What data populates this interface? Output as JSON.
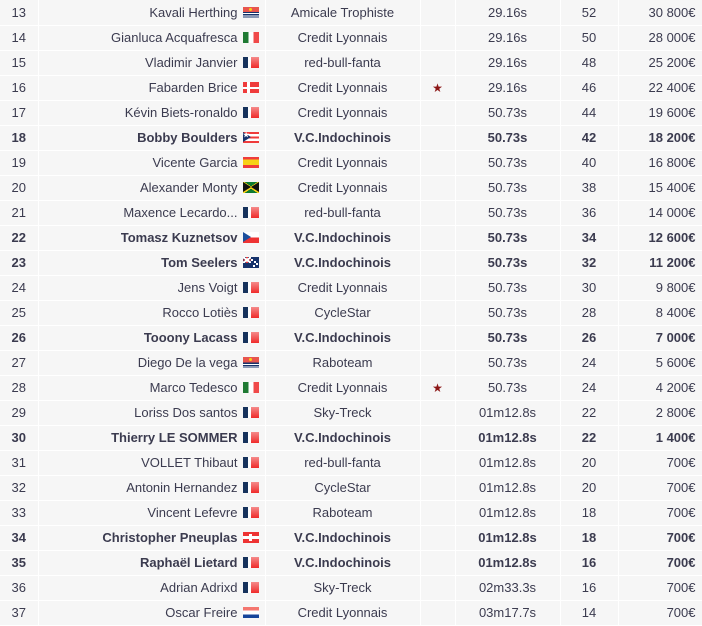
{
  "colors": {
    "row_background": "#f6f6f6",
    "page_background": "#ffffff",
    "default_text": "#3b3b4f",
    "name_text": "#a9cd5e",
    "highlight_text": "#00b400",
    "star_marker": "#8c1616"
  },
  "table": {
    "name": "race-ranking-table",
    "star_symbol": "★",
    "rows": [
      {
        "rank": "13",
        "name": "Kavali Herthing",
        "flag": "ki",
        "flag_name": "flag-kiribati",
        "team": "Amicale Trophiste",
        "star": "",
        "time": "29.16s",
        "points": "52",
        "cash": "30 800€",
        "highlight": false
      },
      {
        "rank": "14",
        "name": "Gianluca Acquafresca",
        "flag": "it",
        "flag_name": "flag-italy",
        "team": "Credit Lyonnais",
        "star": "",
        "time": "29.16s",
        "points": "50",
        "cash": "28 000€",
        "highlight": false
      },
      {
        "rank": "15",
        "name": "Vladimir Janvier",
        "flag": "fr",
        "flag_name": "flag-france",
        "team": "red-bull-fanta",
        "star": "",
        "time": "29.16s",
        "points": "48",
        "cash": "25 200€",
        "highlight": false
      },
      {
        "rank": "16",
        "name": "Fabarden Brice",
        "flag": "dk",
        "flag_name": "flag-denmark",
        "team": "Credit Lyonnais",
        "star": "★",
        "time": "29.16s",
        "points": "46",
        "cash": "22 400€",
        "highlight": false
      },
      {
        "rank": "17",
        "name": "Kévin Biets-ronaldo",
        "flag": "fr",
        "flag_name": "flag-france",
        "team": "Credit Lyonnais",
        "star": "",
        "time": "50.73s",
        "points": "44",
        "cash": "19 600€",
        "highlight": false
      },
      {
        "rank": "18",
        "name": "Bobby Boulders",
        "flag": "pr",
        "flag_name": "flag-puerto-rico",
        "team": "V.C.Indochinois",
        "star": "",
        "time": "50.73s",
        "points": "42",
        "cash": "18 200€",
        "highlight": true
      },
      {
        "rank": "19",
        "name": "Vicente Garcia",
        "flag": "es",
        "flag_name": "flag-spain",
        "team": "Credit Lyonnais",
        "star": "",
        "time": "50.73s",
        "points": "40",
        "cash": "16 800€",
        "highlight": false
      },
      {
        "rank": "20",
        "name": "Alexander Monty",
        "flag": "jm",
        "flag_name": "flag-jamaica",
        "team": "Credit Lyonnais",
        "star": "",
        "time": "50.73s",
        "points": "38",
        "cash": "15 400€",
        "highlight": false
      },
      {
        "rank": "21",
        "name": "Maxence Lecardo...",
        "flag": "fr",
        "flag_name": "flag-france",
        "team": "red-bull-fanta",
        "star": "",
        "time": "50.73s",
        "points": "36",
        "cash": "14 000€",
        "highlight": false
      },
      {
        "rank": "22",
        "name": "Tomasz Kuznetsov",
        "flag": "cz",
        "flag_name": "flag-czech-republic",
        "team": "V.C.Indochinois",
        "star": "",
        "time": "50.73s",
        "points": "34",
        "cash": "12 600€",
        "highlight": true
      },
      {
        "rank": "23",
        "name": "Tom Seelers",
        "flag": "nz",
        "flag_name": "flag-new-zealand",
        "team": "V.C.Indochinois",
        "star": "",
        "time": "50.73s",
        "points": "32",
        "cash": "11 200€",
        "highlight": true
      },
      {
        "rank": "24",
        "name": "Jens Voigt",
        "flag": "fr",
        "flag_name": "flag-france",
        "team": "Credit Lyonnais",
        "star": "",
        "time": "50.73s",
        "points": "30",
        "cash": "9 800€",
        "highlight": false
      },
      {
        "rank": "25",
        "name": "Rocco Lotiès",
        "flag": "fr",
        "flag_name": "flag-france",
        "team": "CycleStar",
        "star": "",
        "time": "50.73s",
        "points": "28",
        "cash": "8 400€",
        "highlight": false
      },
      {
        "rank": "26",
        "name": "Tooony Lacass",
        "flag": "fr",
        "flag_name": "flag-france",
        "team": "V.C.Indochinois",
        "star": "",
        "time": "50.73s",
        "points": "26",
        "cash": "7 000€",
        "highlight": true
      },
      {
        "rank": "27",
        "name": "Diego De la vega",
        "flag": "ki",
        "flag_name": "flag-kiribati",
        "team": "Raboteam",
        "star": "",
        "time": "50.73s",
        "points": "24",
        "cash": "5 600€",
        "highlight": false
      },
      {
        "rank": "28",
        "name": "Marco Tedesco",
        "flag": "it",
        "flag_name": "flag-italy",
        "team": "Credit Lyonnais",
        "star": "★",
        "time": "50.73s",
        "points": "24",
        "cash": "4 200€",
        "highlight": false
      },
      {
        "rank": "29",
        "name": "Loriss Dos santos",
        "flag": "fr",
        "flag_name": "flag-france",
        "team": "Sky-Treck",
        "star": "",
        "time": "01m12.8s",
        "points": "22",
        "cash": "2 800€",
        "highlight": false
      },
      {
        "rank": "30",
        "name": "Thierry LE SOMMER",
        "flag": "fr",
        "flag_name": "flag-france",
        "team": "V.C.Indochinois",
        "star": "",
        "time": "01m12.8s",
        "points": "22",
        "cash": "1 400€",
        "highlight": true
      },
      {
        "rank": "31",
        "name": "VOLLET Thibaut",
        "flag": "fr",
        "flag_name": "flag-france",
        "team": "red-bull-fanta",
        "star": "",
        "time": "01m12.8s",
        "points": "20",
        "cash": "700€",
        "highlight": false
      },
      {
        "rank": "32",
        "name": "Antonin Hernandez",
        "flag": "fr",
        "flag_name": "flag-france",
        "team": "CycleStar",
        "star": "",
        "time": "01m12.8s",
        "points": "20",
        "cash": "700€",
        "highlight": false
      },
      {
        "rank": "33",
        "name": "Vincent Lefevre",
        "flag": "fr",
        "flag_name": "flag-france",
        "team": "Raboteam",
        "star": "",
        "time": "01m12.8s",
        "points": "18",
        "cash": "700€",
        "highlight": false
      },
      {
        "rank": "34",
        "name": "Christopher Pneuplas",
        "flag": "ch",
        "flag_name": "flag-switzerland",
        "team": "V.C.Indochinois",
        "star": "",
        "time": "01m12.8s",
        "points": "18",
        "cash": "700€",
        "highlight": true
      },
      {
        "rank": "35",
        "name": "Raphaël Lietard",
        "flag": "fr",
        "flag_name": "flag-france",
        "team": "V.C.Indochinois",
        "star": "",
        "time": "01m12.8s",
        "points": "16",
        "cash": "700€",
        "highlight": true
      },
      {
        "rank": "36",
        "name": "Adrian Adrixd",
        "flag": "fr",
        "flag_name": "flag-france",
        "team": "Sky-Treck",
        "star": "",
        "time": "02m33.3s",
        "points": "16",
        "cash": "700€",
        "highlight": false
      },
      {
        "rank": "37",
        "name": "Oscar Freire",
        "flag": "nl",
        "flag_name": "flag-netherlands",
        "team": "Credit Lyonnais",
        "star": "",
        "time": "03m17.7s",
        "points": "14",
        "cash": "700€",
        "highlight": false
      }
    ]
  }
}
